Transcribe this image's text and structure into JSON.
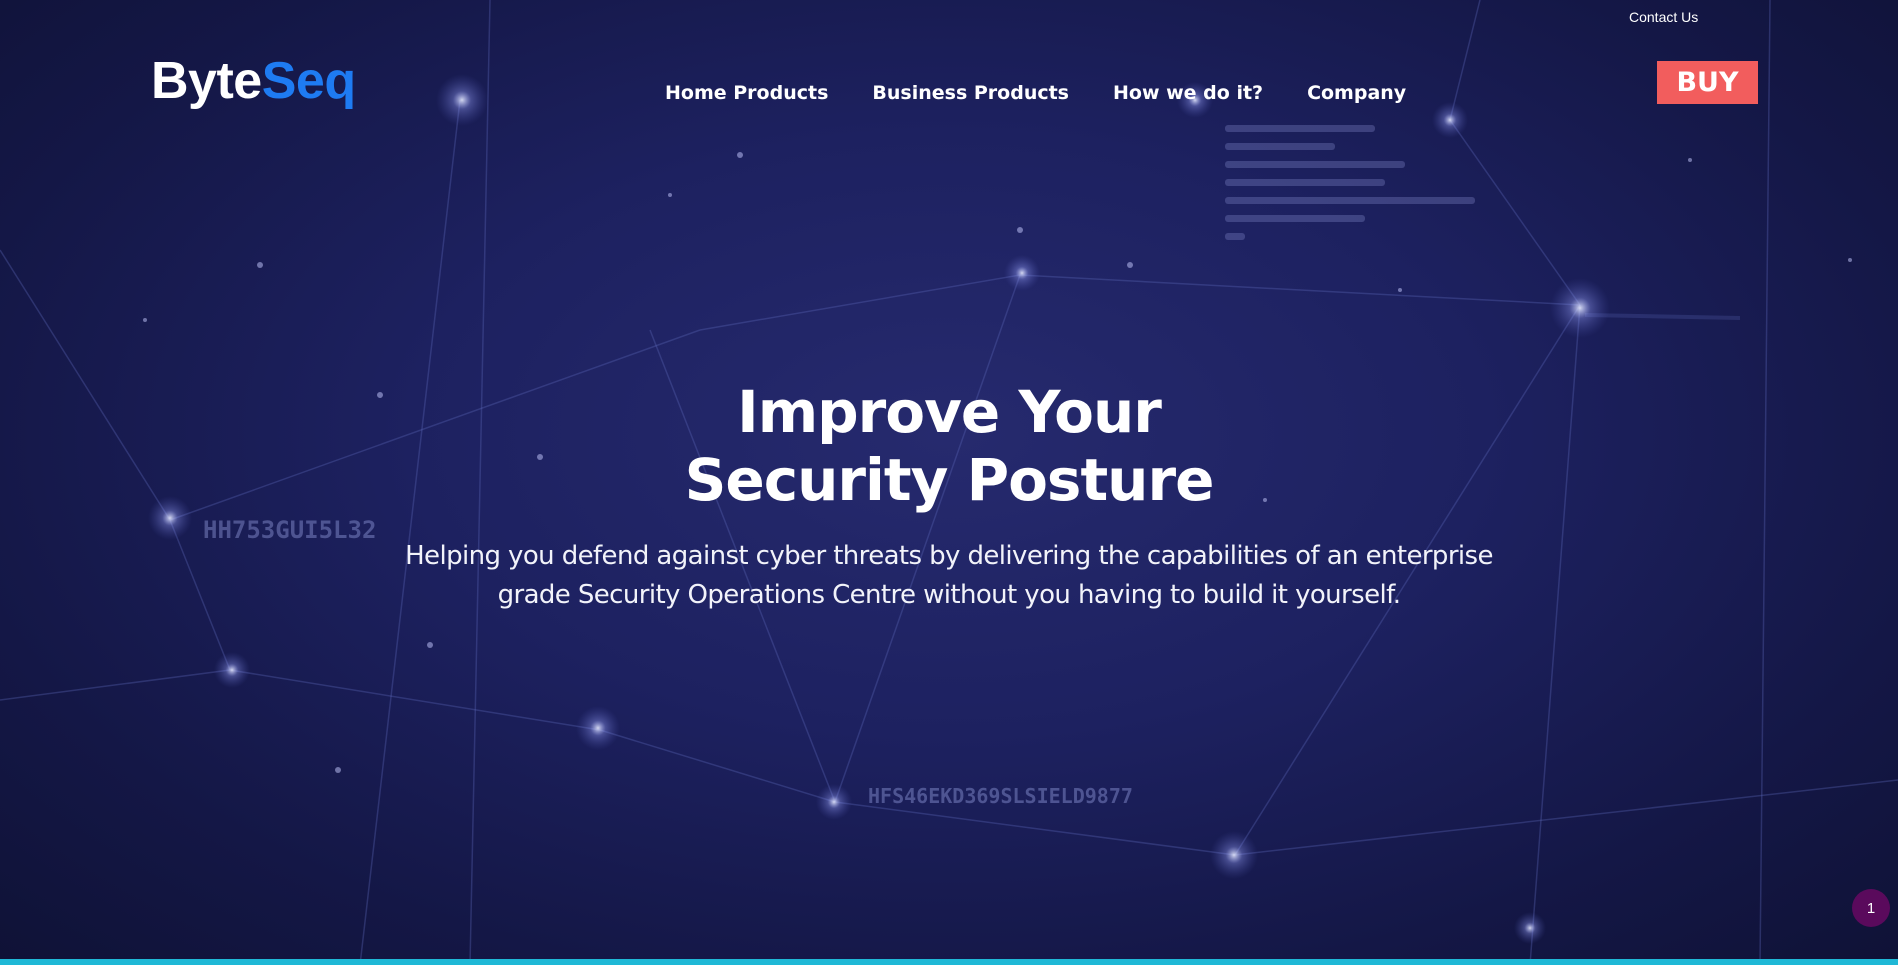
{
  "header": {
    "contact_label": "Contact Us",
    "logo": {
      "part1": "Byte",
      "part2": "Seq"
    },
    "nav": [
      "Home Products",
      "Business Products",
      "How we do it?",
      "Company"
    ],
    "buy_label": "BUY"
  },
  "hero": {
    "headline": [
      "Improve Your",
      "Security Posture"
    ],
    "subtext": [
      "Helping you defend against cyber threats by delivering the capabilities of an enterprise",
      "grade Security Operations Centre without you having to build it yourself."
    ],
    "background_codes": [
      "HH753GUI5L32",
      "HFS46EKD369SLSIELD9877"
    ]
  },
  "chat": {
    "badge_count": "1"
  },
  "colors": {
    "background": "#1d2160",
    "brand_blue": "#1e7bf2",
    "buy_red": "#f25d5d",
    "badge_purple": "#5a0a5c",
    "bottom_bar": "#1fb8d6"
  }
}
